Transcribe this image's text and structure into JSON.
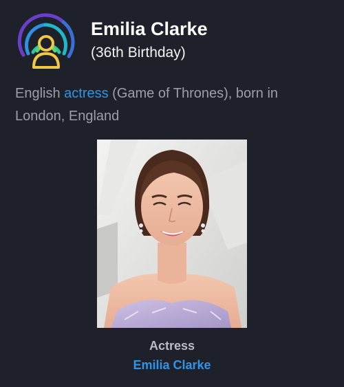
{
  "colors": {
    "background": "#1e2129",
    "link": "#2f95e8",
    "muted_text": "#9aa0a9"
  },
  "header": {
    "logo_icon": "person-broadcast-icon",
    "name": "Emilia Clarke",
    "subtitle": "(36th Birthday)"
  },
  "description": {
    "before_link": "English ",
    "link_text": "actress",
    "after_link": " (Game of Thrones), born in London, England"
  },
  "photo": {
    "caption_role": "Actress",
    "caption_name": "Emilia Clarke"
  }
}
